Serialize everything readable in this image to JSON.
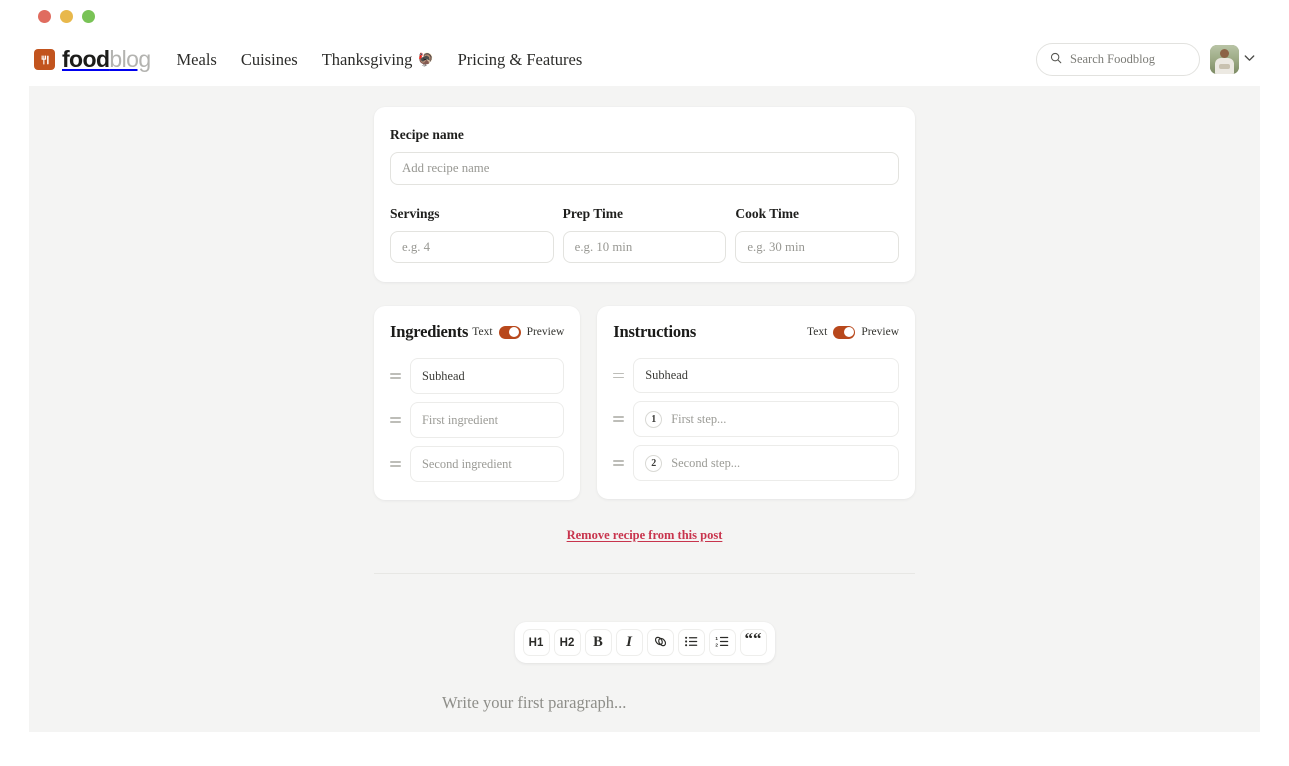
{
  "window": {
    "traffic_lights": [
      "close",
      "minimize",
      "maximize"
    ]
  },
  "header": {
    "brand": {
      "food": "food",
      "blog": "blog",
      "icon": "fork-logo-icon"
    },
    "nav": [
      {
        "label": "Meals",
        "emoji": ""
      },
      {
        "label": "Cuisines",
        "emoji": ""
      },
      {
        "label": "Thanksgiving",
        "emoji": "🦃"
      },
      {
        "label": "Pricing & Features",
        "emoji": ""
      }
    ],
    "search": {
      "placeholder": "Search Foodblog",
      "icon": "search-icon"
    },
    "account": {
      "avatar": "user-avatar",
      "chevron": "⌄"
    }
  },
  "recipe_meta": {
    "recipe_name": {
      "label": "Recipe name",
      "placeholder": "Add recipe name",
      "value": ""
    },
    "servings": {
      "label": "Servings",
      "placeholder": "e.g. 4",
      "value": ""
    },
    "prep_time": {
      "label": "Prep Time",
      "placeholder": "e.g. 10 min",
      "value": ""
    },
    "cook_time": {
      "label": "Cook Time",
      "placeholder": "e.g. 30 min",
      "value": ""
    }
  },
  "ingredients": {
    "title": "Ingredients",
    "toggle": {
      "left_label": "Text",
      "right_label": "Preview",
      "state": "preview",
      "color": "#b8481c"
    },
    "rows": [
      {
        "text": "Subhead",
        "kind": "subhead"
      },
      {
        "text": "First ingredient",
        "kind": "placeholder"
      },
      {
        "text": "Second ingredient",
        "kind": "placeholder"
      }
    ]
  },
  "instructions": {
    "title": "Instructions",
    "toggle": {
      "left_label": "Text",
      "right_label": "Preview",
      "state": "preview",
      "color": "#b8481c"
    },
    "rows": [
      {
        "text": "Subhead",
        "kind": "subhead",
        "number": ""
      },
      {
        "text": "First step...",
        "kind": "placeholder",
        "number": "1"
      },
      {
        "text": "Second step...",
        "kind": "placeholder",
        "number": "2"
      }
    ]
  },
  "remove_link": {
    "label": "Remove recipe from this post",
    "color": "#c8344d"
  },
  "editor": {
    "toolbar": [
      {
        "label": "H1",
        "name": "heading-1"
      },
      {
        "label": "H2",
        "name": "heading-2"
      },
      {
        "label": "B",
        "name": "bold"
      },
      {
        "label": "I",
        "name": "italic"
      },
      {
        "label": "link-icon",
        "name": "link"
      },
      {
        "label": "bullet-list-icon",
        "name": "bullet-list"
      },
      {
        "label": "numbered-list-icon",
        "name": "numbered-list"
      },
      {
        "label": "““",
        "name": "blockquote"
      }
    ],
    "placeholder": "Write your first paragraph..."
  },
  "colors": {
    "brand_orange": "#c2541e",
    "page_bg": "#f4f4f3",
    "accent_red": "#c8344d",
    "toggle_on": "#b8481c"
  }
}
